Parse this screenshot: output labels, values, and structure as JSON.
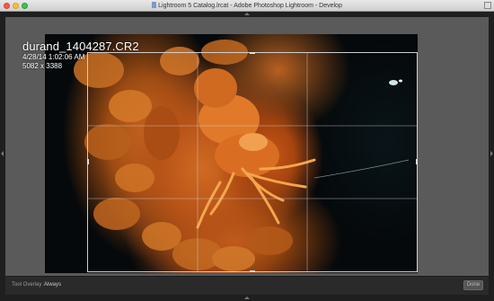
{
  "window": {
    "title": "Lightroom 5 Catalog.lrcat - Adobe Photoshop Lightroom - Develop"
  },
  "photo_info": {
    "filename": "durand_1404287.CR2",
    "datetime": "4/28/14 1:02:06 AM",
    "dimensions": "5082 x 3388"
  },
  "toolbar": {
    "tool_overlay_label": "Tool Overlay :",
    "tool_overlay_value": "Always",
    "done_label": "Done"
  },
  "icons": {
    "top_panel_toggle": "triangle-up-icon",
    "left_panel_toggle": "triangle-left-icon",
    "right_panel_toggle": "triangle-right-icon",
    "bottom_panel_toggle": "triangle-up-icon"
  },
  "colors": {
    "workarea": "#5a5a5a",
    "toolbar": "#2a2a2a",
    "crop_frame": "#cfcfcf"
  }
}
